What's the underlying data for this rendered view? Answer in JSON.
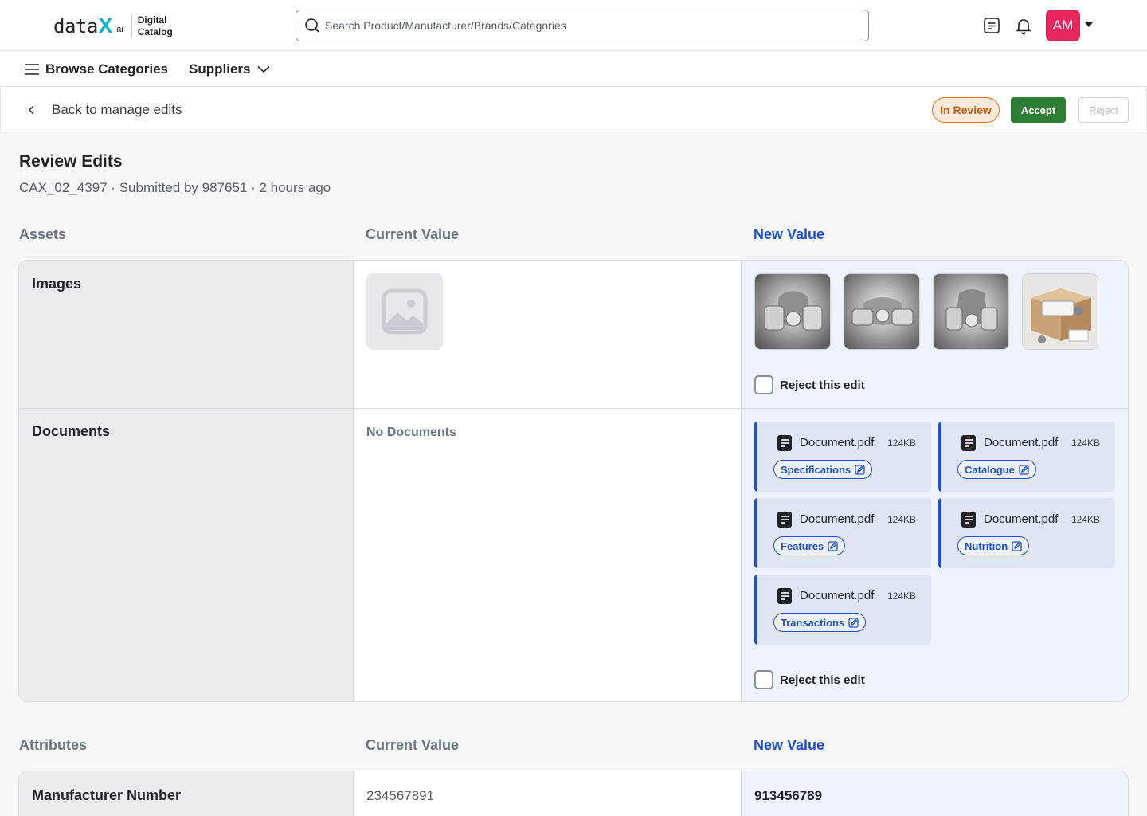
{
  "header": {
    "logo_word": "data",
    "logo_x": "X",
    "logo_ai": ".ai",
    "logo_sub_line1": "Digital",
    "logo_sub_line2": "Catalog",
    "search_placeholder": "Search Product/Manufacturer/Brands/Categories",
    "avatar_initials": "AM"
  },
  "nav": {
    "browse_label": "Browse Categories",
    "suppliers_label": "Suppliers"
  },
  "editbar": {
    "back_label": "Back to manage edits",
    "status_label": "In Review",
    "accept_label": "Accept",
    "reject_label": "Reject"
  },
  "page": {
    "title": "Review Edits",
    "subtitle": "CAX_02_4397 · Submitted by 987651 · 2 hours ago"
  },
  "assets": {
    "section_label": "Assets",
    "current_label": "Current Value",
    "new_label": "New Value",
    "images_label": "Images",
    "documents_label": "Documents",
    "no_documents": "No Documents",
    "reject_edit_label": "Reject this edit",
    "documents": [
      {
        "name": "Document.pdf",
        "size": "124KB",
        "tag": "Specifications"
      },
      {
        "name": "Document.pdf",
        "size": "124KB",
        "tag": "Catalogue"
      },
      {
        "name": "Document.pdf",
        "size": "124KB",
        "tag": "Features"
      },
      {
        "name": "Document.pdf",
        "size": "124KB",
        "tag": "Nutrition"
      },
      {
        "name": "Document.pdf",
        "size": "124KB",
        "tag": "Transactions"
      }
    ]
  },
  "attributes": {
    "section_label": "Attributes",
    "current_label": "Current Value",
    "new_label": "New Value",
    "rows": [
      {
        "label": "Manufacturer Number",
        "current": "234567891",
        "new": "913456789"
      }
    ]
  },
  "colors": {
    "accent_blue": "#1d4ed8",
    "accept_green": "#2f7d32",
    "review_orange": "#e0741b",
    "avatar_pink": "#e8265e",
    "logo_teal": "#00b3c6"
  }
}
